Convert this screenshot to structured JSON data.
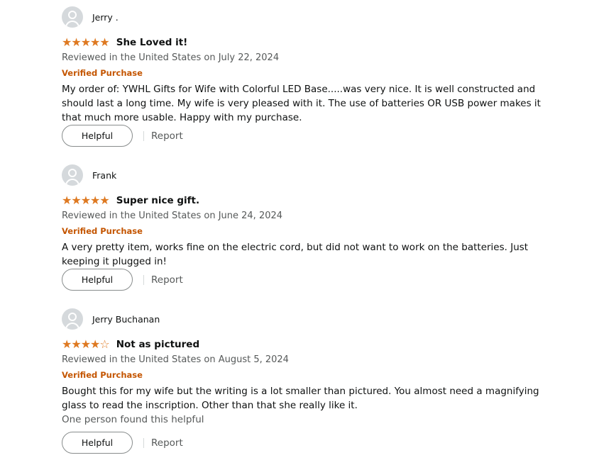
{
  "reviews": [
    {
      "profile_name": "Jerry .",
      "rating": 5,
      "stars_display": "★★★★★",
      "title": "She Loved it!",
      "date_line": "Reviewed in the United States on July 22, 2024",
      "verified_label": "Verified Purchase",
      "body": "My order of: YWHL Gifts for Wife with Colorful LED Base.....was very nice. It is well constructed and should last a long time. My wife is very pleased with it. The use of batteries OR USB power makes it that much more usable. Happy with my purchase.",
      "helpful_count_text": "",
      "helpful_label": "Helpful",
      "report_label": "Report"
    },
    {
      "profile_name": "Frank",
      "rating": 5,
      "stars_display": "★★★★★",
      "title": "Super nice gift.",
      "date_line": "Reviewed in the United States on June 24, 2024",
      "verified_label": "Verified Purchase",
      "body": "A very pretty item, works fine on the electric cord, but did not want to work on the batteries. Just keeping it plugged in!",
      "helpful_count_text": "",
      "helpful_label": "Helpful",
      "report_label": "Report"
    },
    {
      "profile_name": "Jerry Buchanan",
      "rating": 4,
      "stars_display": "★★★★☆",
      "title": "Not as pictured",
      "date_line": "Reviewed in the United States on August 5, 2024",
      "verified_label": "Verified Purchase",
      "body": "Bought this for my wife but the writing is a lot smaller than pictured. You almost need a magnifying glass to read the inscription. Other than that she really like it.",
      "helpful_count_text": "One person found this helpful",
      "helpful_label": "Helpful",
      "report_label": "Report"
    }
  ],
  "colors": {
    "star": "#de7921",
    "verified": "#c45500",
    "secondary_text": "#565959",
    "primary_text": "#0f1111",
    "avatar_bg": "#d5d9dc"
  },
  "icons": {
    "avatar": "default-user-avatar-icon",
    "star_full": "star-filled-icon",
    "star_empty": "star-outline-icon"
  }
}
